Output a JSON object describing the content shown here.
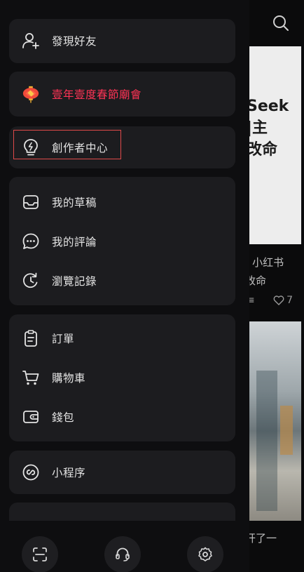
{
  "menu": {
    "find_friends": "發現好友",
    "spring_festival": "壹年壹度春節廟會",
    "creator_center": "創作者中心",
    "drafts": "我的草稿",
    "my_comments": "我的評論",
    "browse_history": "瀏覽記錄",
    "orders": "訂單",
    "cart": "購物車",
    "wallet": "錢包",
    "mini_program": "小程序"
  },
  "bottom_bar": {
    "icons": [
      "scan-icon",
      "customer-service-icon",
      "settings-icon"
    ]
  },
  "background_feed": {
    "card1_title": "Seek\n|主\n改命",
    "card1_caption": "- 小红书\n改命",
    "card1_likes": "7",
    "card2_caption": "开了一"
  },
  "colors": {
    "drawer_bg": "#0e0e10",
    "group_bg": "#1c1c1f",
    "text": "#e4e4e4",
    "festival_red": "#ff3355",
    "highlight_border": "#e04a4a"
  }
}
